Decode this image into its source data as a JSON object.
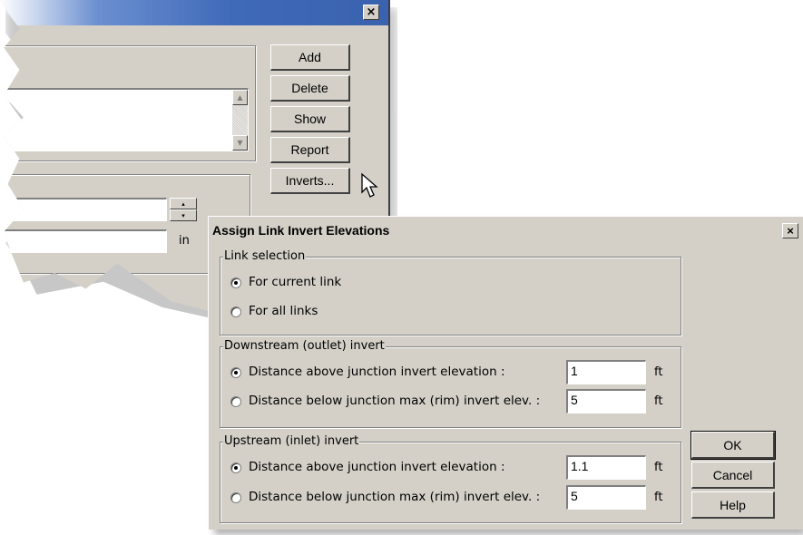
{
  "background_dialog": {
    "close_glyph": "×",
    "buttons": [
      "Add",
      "Delete",
      "Show",
      "Report",
      "Inverts..."
    ],
    "unit_label": "in"
  },
  "dialog": {
    "title": "Assign Link Invert Elevations",
    "close_glyph": "×",
    "link_selection": {
      "label": "Link selection",
      "options": [
        {
          "label": "For current link",
          "selected": true
        },
        {
          "label": "For all links",
          "selected": false
        }
      ]
    },
    "downstream": {
      "label": "Downstream (outlet) invert",
      "rows": [
        {
          "label": "Distance above junction invert elevation :",
          "value": "1",
          "unit": "ft",
          "selected": true
        },
        {
          "label": "Distance below junction max (rim) invert elev. :",
          "value": "5",
          "unit": "ft",
          "selected": false
        }
      ]
    },
    "upstream": {
      "label": "Upstream (inlet) invert",
      "rows": [
        {
          "label": "Distance above junction invert elevation :",
          "value": "1.1",
          "unit": "ft",
          "selected": true
        },
        {
          "label": "Distance below junction max (rim) invert elev. :",
          "value": "5",
          "unit": "ft",
          "selected": false
        }
      ]
    },
    "buttons": {
      "ok": "OK",
      "cancel": "Cancel",
      "help": "Help"
    }
  }
}
